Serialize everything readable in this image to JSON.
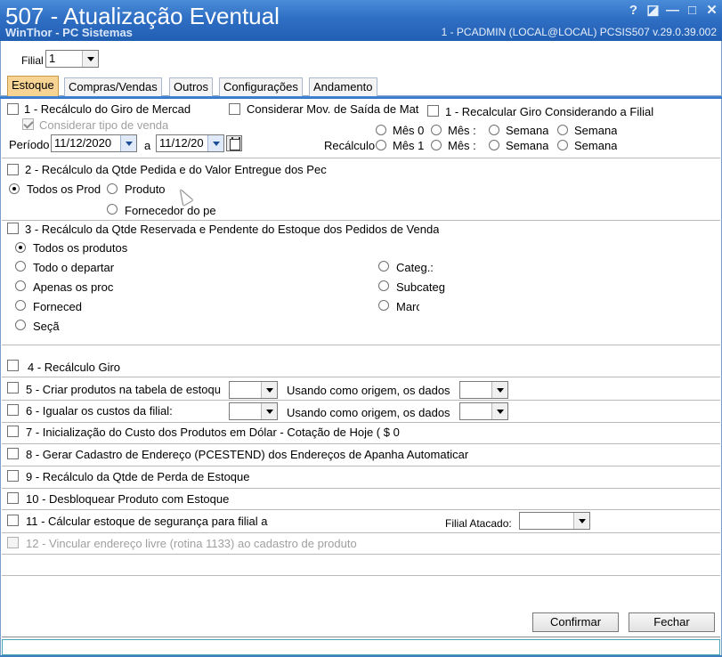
{
  "window": {
    "title": "507 - Atualização Eventual",
    "subtitle": "WinThor - PC Sistemas",
    "session_info": "1 - PCADMIN (LOCAL@LOCAL)   PCSIS507  v.29.0.39.002",
    "controls": {
      "help": "?",
      "restore": "◪",
      "minimize": "—",
      "maximize": "□",
      "close": "✕"
    }
  },
  "filial": {
    "label": "Filial",
    "value": "1"
  },
  "tabs": [
    {
      "label": "Estoque",
      "active": true
    },
    {
      "label": "Compras/Vendas",
      "active": false
    },
    {
      "label": "Outros",
      "active": false
    },
    {
      "label": "Configurações",
      "active": false
    },
    {
      "label": "Andamento",
      "active": false
    }
  ],
  "section1": {
    "recalc_giro": "1 - Recálculo do Giro de Mercad",
    "considerar_mov": "Considerar Mov. de Saída de Mat",
    "recalc_giro_filial": "1 - Recalcular Giro Considerando a Filial",
    "considerar_tipo": "Considerar tipo de venda",
    "periodo_label": "Período",
    "date_from": "11/12/2020",
    "a_label": "a",
    "date_to": "11/12/20",
    "recalculo_label": "Recálculo",
    "opt_mes0": "Mês 0",
    "opt_mes_a": "Mês :",
    "opt_semana_a": "Semana",
    "opt_semana_b": "Semana",
    "opt_mes1": "Mês 1",
    "opt_mes_b": "Mês :",
    "opt_semana_c": "Semana",
    "opt_semana_d": "Semana"
  },
  "section2": {
    "title": "2 - Recálculo da Qtde Pedida e do Valor Entregue dos Pec",
    "todos": "Todos os Prod",
    "produto": "Produto",
    "fornecedor": "Fornecedor do pe"
  },
  "section3": {
    "title": "3 - Recálculo da Qtde Reservada e Pendente do Estoque dos Pedidos de Venda",
    "todos": "Todos os produtos",
    "departamento": "Todo o departar",
    "apenas": "Apenas os proc",
    "fornecedor": "Forneced",
    "secao": "Seçã",
    "categ": "Categ.:",
    "subcateg": "Subcateg",
    "marca": "Marc"
  },
  "items": {
    "i4": "4 - Recálculo Giro",
    "i5": "5 - Criar produtos na tabela de estoqu",
    "i5_origem": "Usando como origem, os dados",
    "i6": "6 - Igualar os custos da filial:",
    "i6_origem": "Usando como origem, os dados",
    "i7": "7 - Inicialização do Custo dos Produtos em Dólar - Cotação de Hoje ( $ 0",
    "i8": "8 - Gerar Cadastro de Endereço (PCESTEND) dos Endereços de Apanha Automaticar",
    "i9": "9 - Recálculo da Qtde de Perda de Estoque",
    "i10": "10 - Desbloquear Produto com Estoque",
    "i11": "11 - Cálcular estoque de segurança para filial a",
    "i11_atacado": "Filial Atacado:",
    "i12": "12 - Vincular endereço livre (rotina 1133) ao cadastro de produto"
  },
  "buttons": {
    "confirmar": "Confirmar",
    "fechar": "Fechar"
  },
  "colors": {
    "title_blue": "#2f6fc4",
    "active_tab": "#f7d494"
  }
}
